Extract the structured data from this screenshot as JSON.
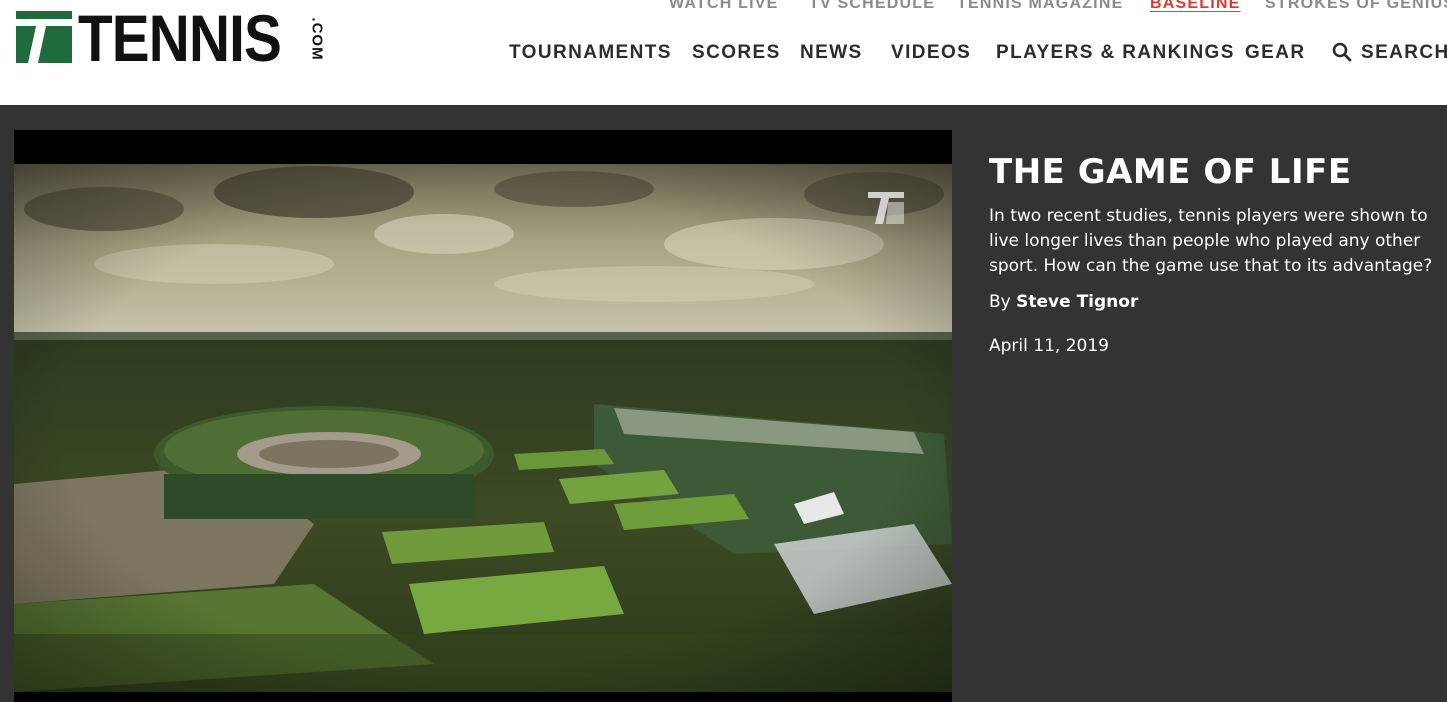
{
  "logo": {
    "wordmark": "TENNIS",
    "suffix": ".COM",
    "mark_color": "#1e6b3c"
  },
  "utility_nav": {
    "items": [
      {
        "label": "WATCH LIVE"
      },
      {
        "label": "TV SCHEDULE"
      },
      {
        "label": "TENNIS MAGAZINE"
      },
      {
        "label": "BASELINE",
        "active": true
      },
      {
        "label": "STROKES OF GENIUS"
      }
    ],
    "active_color": "#e03a2f"
  },
  "main_nav": {
    "items": [
      {
        "label": "TOURNAMENTS"
      },
      {
        "label": "SCORES"
      },
      {
        "label": "NEWS"
      },
      {
        "label": "VIDEOS"
      },
      {
        "label": "PLAYERS & RANKINGS"
      },
      {
        "label": "GEAR"
      }
    ],
    "search": {
      "label": "SEARCH",
      "icon": "search-icon"
    }
  },
  "video": {
    "watermark_icon": "tennis-logo-icon"
  },
  "article": {
    "title": "THE GAME OF LIFE",
    "summary": "In two recent studies, tennis players were shown to live longer lives than people who played any other sport. How can the game use that to its advantage?",
    "byline_prefix": "By",
    "author": "Steve Tignor",
    "date": "April 11, 2019"
  },
  "colors": {
    "header_bg": "#ffffff",
    "page_bg": "#333333",
    "nav_text": "#2c2c2c",
    "utility_text": "#8a8a8a"
  }
}
